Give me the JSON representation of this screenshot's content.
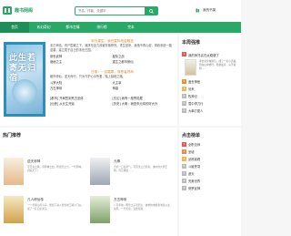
{
  "header": {
    "logo_text": "趣书网阁",
    "search_placeholder": "书名、作者、关键字",
    "history_label": "我的书架",
    "history_icon": "bookshelf-icon"
  },
  "nav": [
    "首页",
    "玄幻奇幻",
    "都市言情",
    "排行榜",
    "完本"
  ],
  "featured": {
    "cover_text": "此生若寄无归宿",
    "block1_title": "末日重生，我在星际抢金融圣",
    "block1_desc": "末日来临，丧尸围城之下，我拼尽全力却被背叛惨死。重生回来，我绝不再心软，带着系统一路逆袭，建立属于自己的末世王国。",
    "block1_rows": [
      [
        "绝世武神",
        "星际之战"
      ],
      [
        "诡秘之主",
        "重生之都市修仙"
      ]
    ],
    "block2_title": "日常：一剑霜寒，邪恶者拼命",
    "block2_desc": "都市修仙，逆天而行，只为守护心中所爱，踏上巅峰之路。",
    "block2_rows": [
      [
        "斗罗大陆",
        "大主宰"
      ],
      [
        "万古神帝",
        "神墓"
      ]
    ],
    "block3_rows": [
      [
        "[都市] 开局签到荒古圣体",
        "[玄幻] 我有一座冒险屋"
      ],
      [
        "[仙侠] 从长生开始",
        "[历史] 大明：我是朱元璋的好大孙"
      ]
    ]
  },
  "newbooks": {
    "title": "本周强推",
    "top_label": "我的师兄实在太稳健了",
    "top_desc": "李长寿穿越洪荒，成了一名小道童，苟在山中修行，稳健发育，从不冒险……",
    "items": [
      "盖世神医",
      "剑来",
      "牧神记",
      "雪中悍刀行",
      "大奉打更人"
    ]
  },
  "hot": {
    "title": "热门推荐",
    "cards": [
      {
        "name": "逆天邪神",
        "desc": "掌天毒之珠，承邪神之血，修逆天之力，一代邪神，君临天下！"
      },
      {
        "name": "元尊",
        "desc": "吾有一口玄黄气，可吞天上日月星。彼时的大周王朝，风云骤起……"
      },
      {
        "name": "凡人修仙传",
        "desc": "一个普通山村小子，偶然下进入到当地江湖小门派，成了一名记名弟子。"
      },
      {
        "name": "万古神帝",
        "desc": "八百年前，明帝之子张若尘，被他的未婚妻池瑶公主杀死，一代天骄，就此陨落。"
      }
    ]
  },
  "click": {
    "title": "点击榜单",
    "items": [
      "全职法师",
      "圣墟",
      "武炼巅峰",
      "斗破苍穹",
      "遮天",
      "完美世界",
      "修罗武神"
    ]
  }
}
